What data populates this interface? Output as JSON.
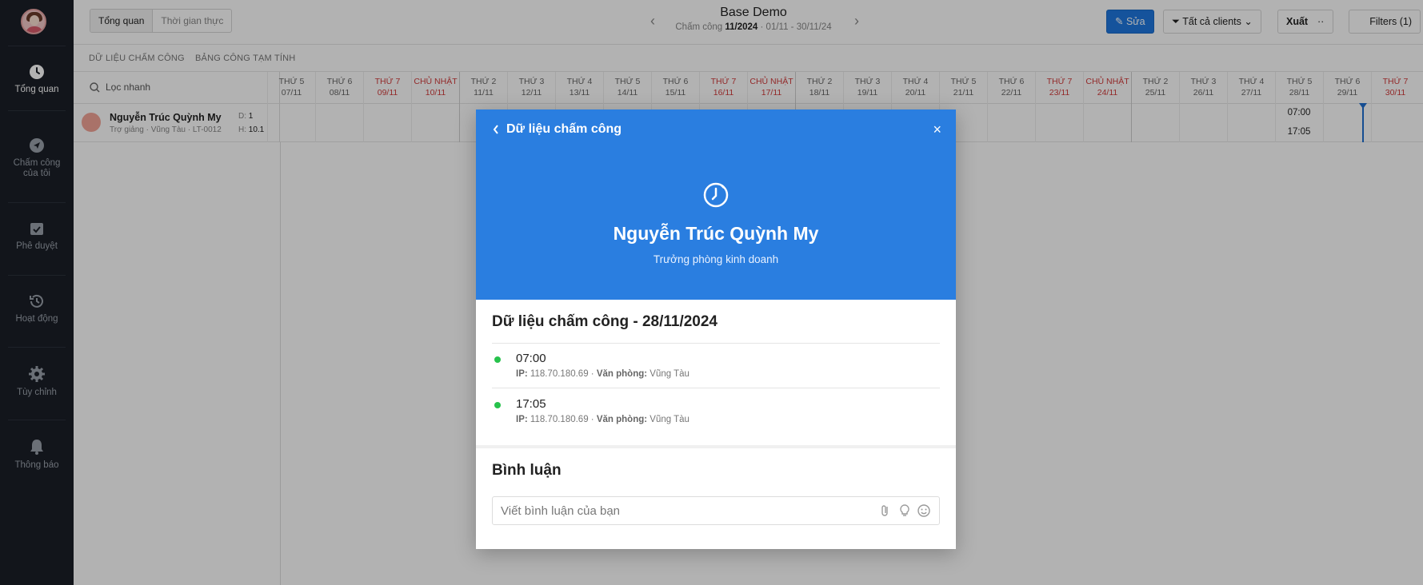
{
  "sidebar": {
    "items": [
      {
        "label": "Tổng quan"
      },
      {
        "label_l1": "Chấm công",
        "label_l2": "của tôi"
      },
      {
        "label": "Phê duyệt"
      },
      {
        "label": "Hoạt động"
      },
      {
        "label": "Tùy chỉnh"
      },
      {
        "label": "Thông báo"
      }
    ]
  },
  "topbar": {
    "view_tabs": [
      "Tổng quan",
      "Thời gian thực"
    ],
    "title": "Base Demo",
    "subtitle_prefix": "Chấm công",
    "subtitle_period": "11/2024",
    "subtitle_range": "· 01/11 - 30/11/24",
    "edit_label": "Sửa",
    "clients_label": "Tất cả clients",
    "export_label": "Xuất",
    "more_label": "··",
    "filters_label": "Filters (1)"
  },
  "subtabs": [
    "DỮ LIỆU CHẤM CÔNG",
    "BẢNG CÔNG TẠM TÍNH"
  ],
  "grid": {
    "search_placeholder": "Lọc nhanh",
    "days": [
      {
        "dow": "THỨ 5",
        "date": "07/11"
      },
      {
        "dow": "THỨ 6",
        "date": "08/11"
      },
      {
        "dow": "THỨ 7",
        "date": "09/11",
        "weekend": true
      },
      {
        "dow": "CHỦ NHẬT",
        "date": "10/11",
        "weekend": true
      },
      {
        "dow": "THỨ 2",
        "date": "11/11"
      },
      {
        "dow": "THỨ 3",
        "date": "12/11"
      },
      {
        "dow": "THỨ 4",
        "date": "13/11"
      },
      {
        "dow": "THỨ 5",
        "date": "14/11"
      },
      {
        "dow": "THỨ 6",
        "date": "15/11"
      },
      {
        "dow": "THỨ 7",
        "date": "16/11",
        "weekend": true
      },
      {
        "dow": "CHỦ NHẬT",
        "date": "17/11",
        "weekend": true
      },
      {
        "dow": "THỨ 2",
        "date": "18/11"
      },
      {
        "dow": "THỨ 3",
        "date": "19/11"
      },
      {
        "dow": "THỨ 4",
        "date": "20/11"
      },
      {
        "dow": "THỨ 5",
        "date": "21/11"
      },
      {
        "dow": "THỨ 6",
        "date": "22/11"
      },
      {
        "dow": "THỨ 7",
        "date": "23/11",
        "weekend": true
      },
      {
        "dow": "CHỦ NHẬT",
        "date": "24/11",
        "weekend": true
      },
      {
        "dow": "THỨ 2",
        "date": "25/11"
      },
      {
        "dow": "THỨ 3",
        "date": "26/11"
      },
      {
        "dow": "THỨ 4",
        "date": "27/11"
      },
      {
        "dow": "THỨ 5",
        "date": "28/11"
      },
      {
        "dow": "THỨ 6",
        "date": "29/11"
      },
      {
        "dow": "THỨ 7",
        "date": "30/11",
        "weekend": true
      }
    ],
    "employee": {
      "name": "Nguyễn Trúc Quỳnh My",
      "sub": "Trợ giảng · Vũng Tàu  · LT-0012",
      "d_label": "D:",
      "d_value": "1",
      "h_label": "H:",
      "h_value": "10.1"
    },
    "cell_28_in": "07:00",
    "cell_28_out": "17:05"
  },
  "modal": {
    "back_label": "Dữ liệu chấm công",
    "close_label": "×",
    "name": "Nguyễn Trúc Quỳnh My",
    "role": "Trưởng phòng kinh doanh",
    "section_title": "Dữ liệu chấm công - 28/11/2024",
    "entries": [
      {
        "time": "07:00",
        "ip_label": "IP:",
        "ip": "118.70.180.69",
        "office_label": "Văn phòng:",
        "office": "Vũng Tàu"
      },
      {
        "time": "17:05",
        "ip_label": "IP:",
        "ip": "118.70.180.69",
        "office_label": "Văn phòng:",
        "office": "Vũng Tàu"
      }
    ],
    "comments_title": "Bình luận",
    "comment_placeholder": "Viết bình luận của bạn"
  },
  "colors": {
    "sidebar_bg": "#1b1f27",
    "primary": "#1f78e0",
    "modal_header": "#2a7ee0",
    "weekend": "#d23b3b",
    "dot": "#27c24c"
  }
}
